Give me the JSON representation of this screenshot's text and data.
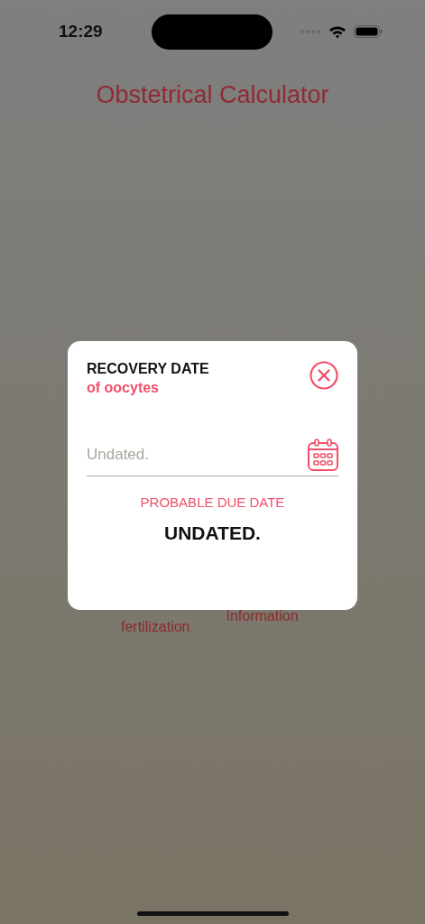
{
  "status_bar": {
    "time": "12:29"
  },
  "screen": {
    "title": "Obstetrical Calculator",
    "menu_labels": [
      {
        "text": "fertilization"
      },
      {
        "text": "Information"
      }
    ]
  },
  "dialog": {
    "title": "RECOVERY DATE",
    "subtitle": "of oocytes",
    "date_field": {
      "placeholder": "Undated."
    },
    "result_label": "PROBABLE DUE DATE",
    "result_value": "UNDATED."
  }
}
